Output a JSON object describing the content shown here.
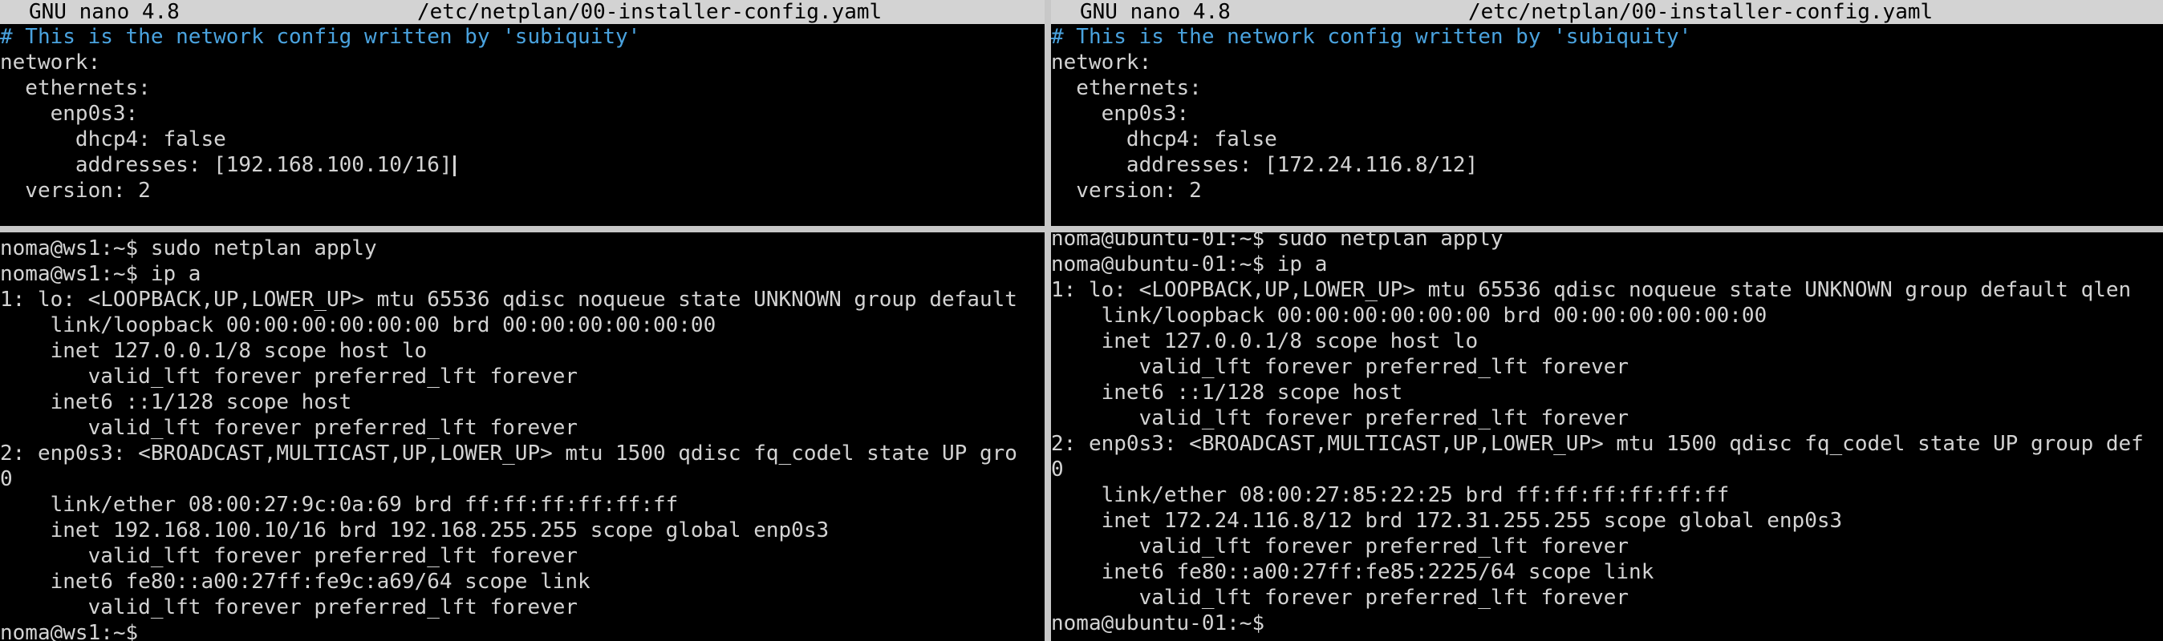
{
  "nano_left": {
    "version_label": "GNU nano 4.8",
    "file_path": "/etc/netplan/00-installer-config.yaml",
    "lines": [
      "# This is the network config written by 'subiquity'",
      "network:",
      "  ethernets:",
      "    enp0s3:",
      "      dhcp4: false",
      "      addresses: [192.168.100.10/16]",
      "  version: 2"
    ]
  },
  "nano_right": {
    "version_label": "GNU nano 4.8",
    "file_path": "/etc/netplan/00-installer-config.yaml",
    "lines": [
      "# This is the network config written by 'subiquity'",
      "network:",
      "  ethernets:",
      "    enp0s3:",
      "      dhcp4: false",
      "      addresses: [172.24.116.8/12]",
      "  version: 2"
    ]
  },
  "shell_left": {
    "lines": [
      "noma@ws1:~$ sudo netplan apply",
      "noma@ws1:~$ ip a",
      "1: lo: <LOOPBACK,UP,LOWER_UP> mtu 65536 qdisc noqueue state UNKNOWN group default",
      "    link/loopback 00:00:00:00:00:00 brd 00:00:00:00:00:00",
      "    inet 127.0.0.1/8 scope host lo",
      "       valid_lft forever preferred_lft forever",
      "    inet6 ::1/128 scope host",
      "       valid_lft forever preferred_lft forever",
      "2: enp0s3: <BROADCAST,MULTICAST,UP,LOWER_UP> mtu 1500 qdisc fq_codel state UP gro",
      "0",
      "    link/ether 08:00:27:9c:0a:69 brd ff:ff:ff:ff:ff:ff",
      "    inet 192.168.100.10/16 brd 192.168.255.255 scope global enp0s3",
      "       valid_lft forever preferred_lft forever",
      "    inet6 fe80::a00:27ff:fe9c:a69/64 scope link",
      "       valid_lft forever preferred_lft forever",
      "noma@ws1:~$"
    ]
  },
  "shell_right": {
    "lines": [
      "noma@ubuntu-01:~$ sudo netplan apply",
      "noma@ubuntu-01:~$ ip a",
      "1: lo: <LOOPBACK,UP,LOWER_UP> mtu 65536 qdisc noqueue state UNKNOWN group default qlen",
      "    link/loopback 00:00:00:00:00:00 brd 00:00:00:00:00:00",
      "    inet 127.0.0.1/8 scope host lo",
      "       valid_lft forever preferred_lft forever",
      "    inet6 ::1/128 scope host",
      "       valid_lft forever preferred_lft forever",
      "2: enp0s3: <BROADCAST,MULTICAST,UP,LOWER_UP> mtu 1500 qdisc fq_codel state UP group def",
      "0",
      "    link/ether 08:00:27:85:22:25 brd ff:ff:ff:ff:ff:ff",
      "    inet 172.24.116.8/12 brd 172.31.255.255 scope global enp0s3",
      "       valid_lft forever preferred_lft forever",
      "    inet6 fe80::a00:27ff:fe85:2225/64 scope link",
      "       valid_lft forever preferred_lft forever",
      "noma@ubuntu-01:~$"
    ]
  },
  "colors": {
    "background": "#000000",
    "foreground": "#d3d3d3",
    "comment": "#4aa3df",
    "titlebar_bg": "#d3d3d3",
    "separator": "#c8c8c8"
  }
}
